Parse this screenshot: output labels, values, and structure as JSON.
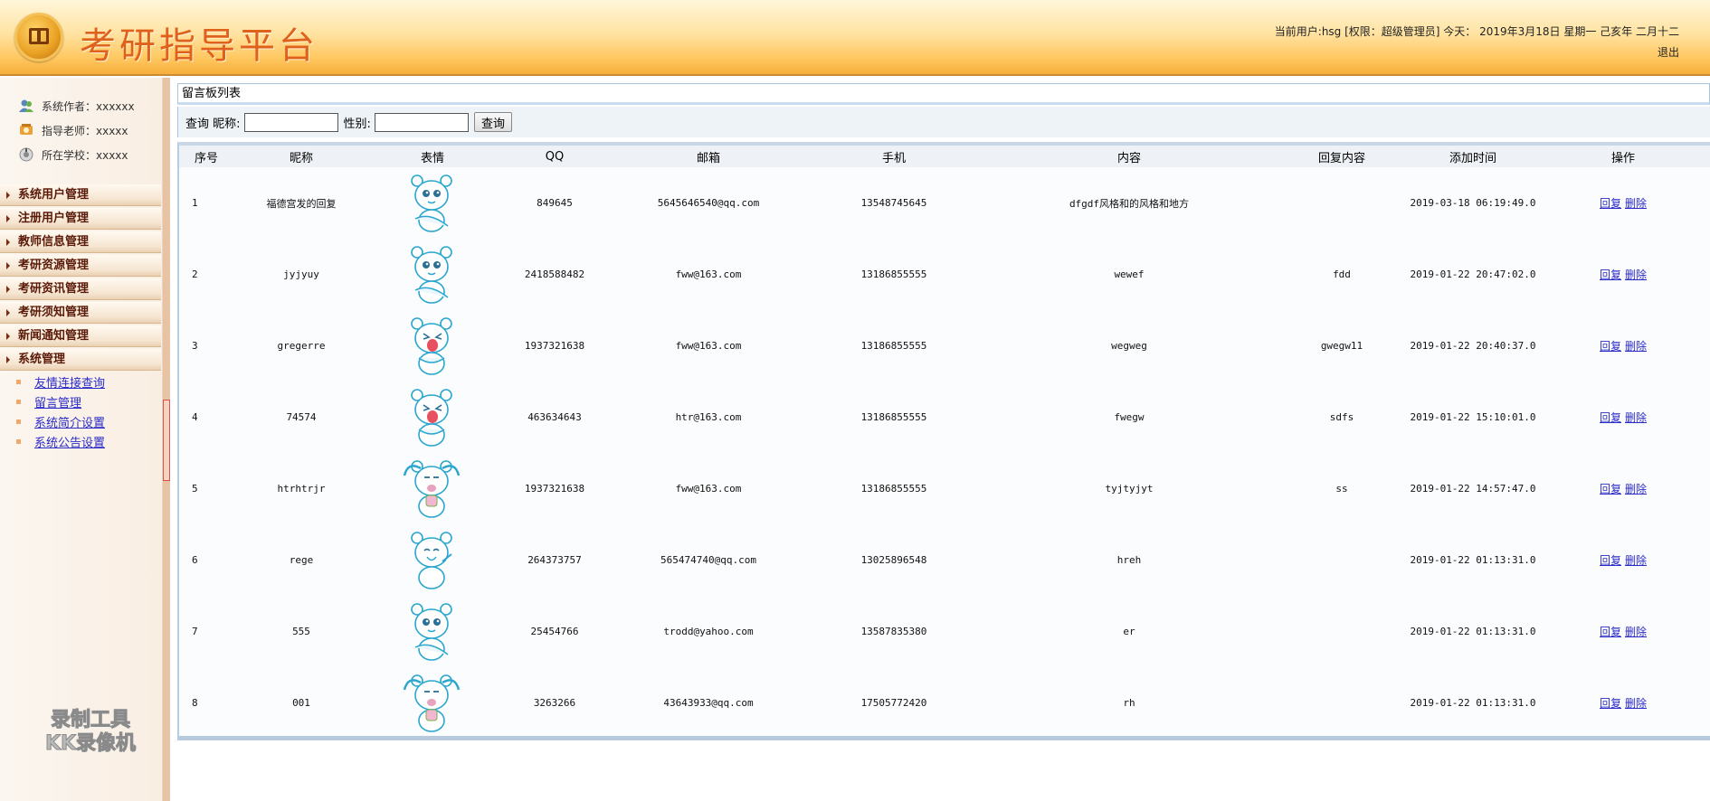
{
  "header": {
    "app_title": "考研指导平台",
    "user_info": "当前用户:hsg [权限：超级管理员] 今天： 2019年3月18日 星期一 己亥年 二月十二",
    "logout_label": "退出"
  },
  "sidebar": {
    "info": [
      {
        "label": "系统作者：xxxxxx",
        "icon": "users-icon"
      },
      {
        "label": "指导老师：xxxxx",
        "icon": "teacher-icon"
      },
      {
        "label": "所在学校：xxxxx",
        "icon": "school-icon"
      }
    ],
    "menu": [
      "系统用户管理",
      "注册用户管理",
      "教师信息管理",
      "考研资源管理",
      "考研资讯管理",
      "考研须知管理",
      "新闻通知管理",
      "系统管理"
    ],
    "submenu": [
      "友情连接查询",
      "留言管理",
      "系统简介设置",
      "系统公告设置"
    ],
    "watermark": [
      "录制工具",
      "KK录像机"
    ]
  },
  "main": {
    "panel_title": "留言板列表",
    "search": {
      "query_label": "查询",
      "nickname_label": "昵称:",
      "gender_label": "性别:",
      "button_label": "查询"
    },
    "columns": [
      "序号",
      "昵称",
      "表情",
      "QQ",
      "邮箱",
      "手机",
      "内容",
      "回复内容",
      "添加时间",
      "操作"
    ],
    "actions": {
      "reply": "回复",
      "delete": "删除"
    },
    "rows": [
      {
        "idx": "1",
        "nickname": "福德宫发的回复",
        "emoji": "smile-bear",
        "qq": "849645",
        "email": "5645646540@qq.com",
        "phone": "13548745645",
        "content": "dfgdf风格和的风格和地方",
        "reply": "",
        "time": "2019-03-18 06:19:49.0"
      },
      {
        "idx": "2",
        "nickname": "jyjyuy",
        "emoji": "smile-bear",
        "qq": "2418588482",
        "email": "fww@163.com",
        "phone": "13186855555",
        "content": "wewef",
        "reply": "fdd",
        "time": "2019-01-22 20:47:02.0"
      },
      {
        "idx": "3",
        "nickname": "gregerre",
        "emoji": "shout-bear",
        "qq": "1937321638",
        "email": "fww@163.com",
        "phone": "13186855555",
        "content": "wegweg",
        "reply": "gwegw11",
        "time": "2019-01-22 20:40:37.0"
      },
      {
        "idx": "4",
        "nickname": "74574",
        "emoji": "shout-bear",
        "qq": "463634643",
        "email": "htr@163.com",
        "phone": "13186855555",
        "content": "fwegw",
        "reply": "sdfs",
        "time": "2019-01-22 15:10:01.0"
      },
      {
        "idx": "5",
        "nickname": "htrhtrjr",
        "emoji": "cry-bear",
        "qq": "1937321638",
        "email": "fww@163.com",
        "phone": "13186855555",
        "content": "tyjtyjyt",
        "reply": "ss",
        "time": "2019-01-22 14:57:47.0"
      },
      {
        "idx": "6",
        "nickname": "rege",
        "emoji": "laugh-bear",
        "qq": "264373757",
        "email": "565474740@qq.com",
        "phone": "13025896548",
        "content": "hreh",
        "reply": "",
        "time": "2019-01-22 01:13:31.0"
      },
      {
        "idx": "7",
        "nickname": "555",
        "emoji": "smile-bear",
        "qq": "25454766",
        "email": "trodd@yahoo.com",
        "phone": "13587835380",
        "content": "er",
        "reply": "",
        "time": "2019-01-22 01:13:31.0"
      },
      {
        "idx": "8",
        "nickname": "001",
        "emoji": "cry-bear",
        "qq": "3263266",
        "email": "43643933@qq.com",
        "phone": "17505772420",
        "content": "rh",
        "reply": "",
        "time": "2019-01-22 01:13:31.0"
      }
    ]
  },
  "colors": {
    "title": "#e0611b",
    "link": "#2b2bc8",
    "menu_text": "#5b1a08"
  }
}
